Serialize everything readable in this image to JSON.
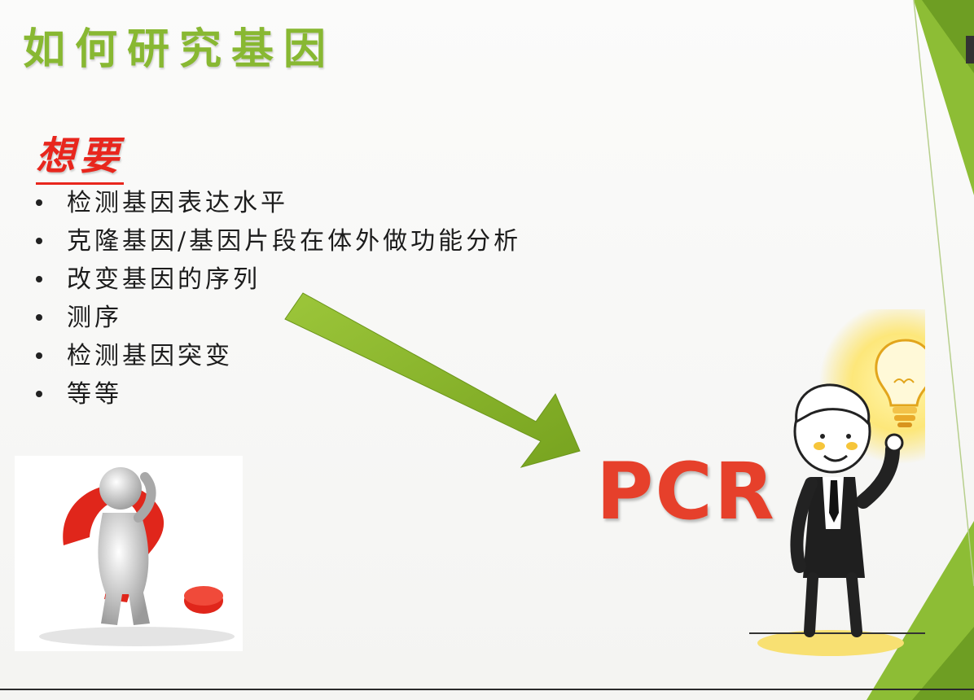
{
  "slide": {
    "title": "如何研究基因",
    "subtitle": "想要",
    "bullets": [
      "检测基因表达水平",
      "克隆基因/基因片段在体外做功能分析",
      "改变基因的序列",
      "测序",
      "检测基因突变",
      "等等"
    ],
    "result_label": "PCR"
  },
  "colors": {
    "title": "#88b832",
    "subtitle": "#e8261d",
    "arrow": "#86b22a",
    "pcr": "#e6402b",
    "corner_green": "#8dbd35"
  },
  "icons": {
    "arrow": "arrow-right-down-icon",
    "question_figure": "question-mark-figure-icon",
    "idea_man": "idea-man-icon",
    "lightbulb": "lightbulb-icon"
  }
}
